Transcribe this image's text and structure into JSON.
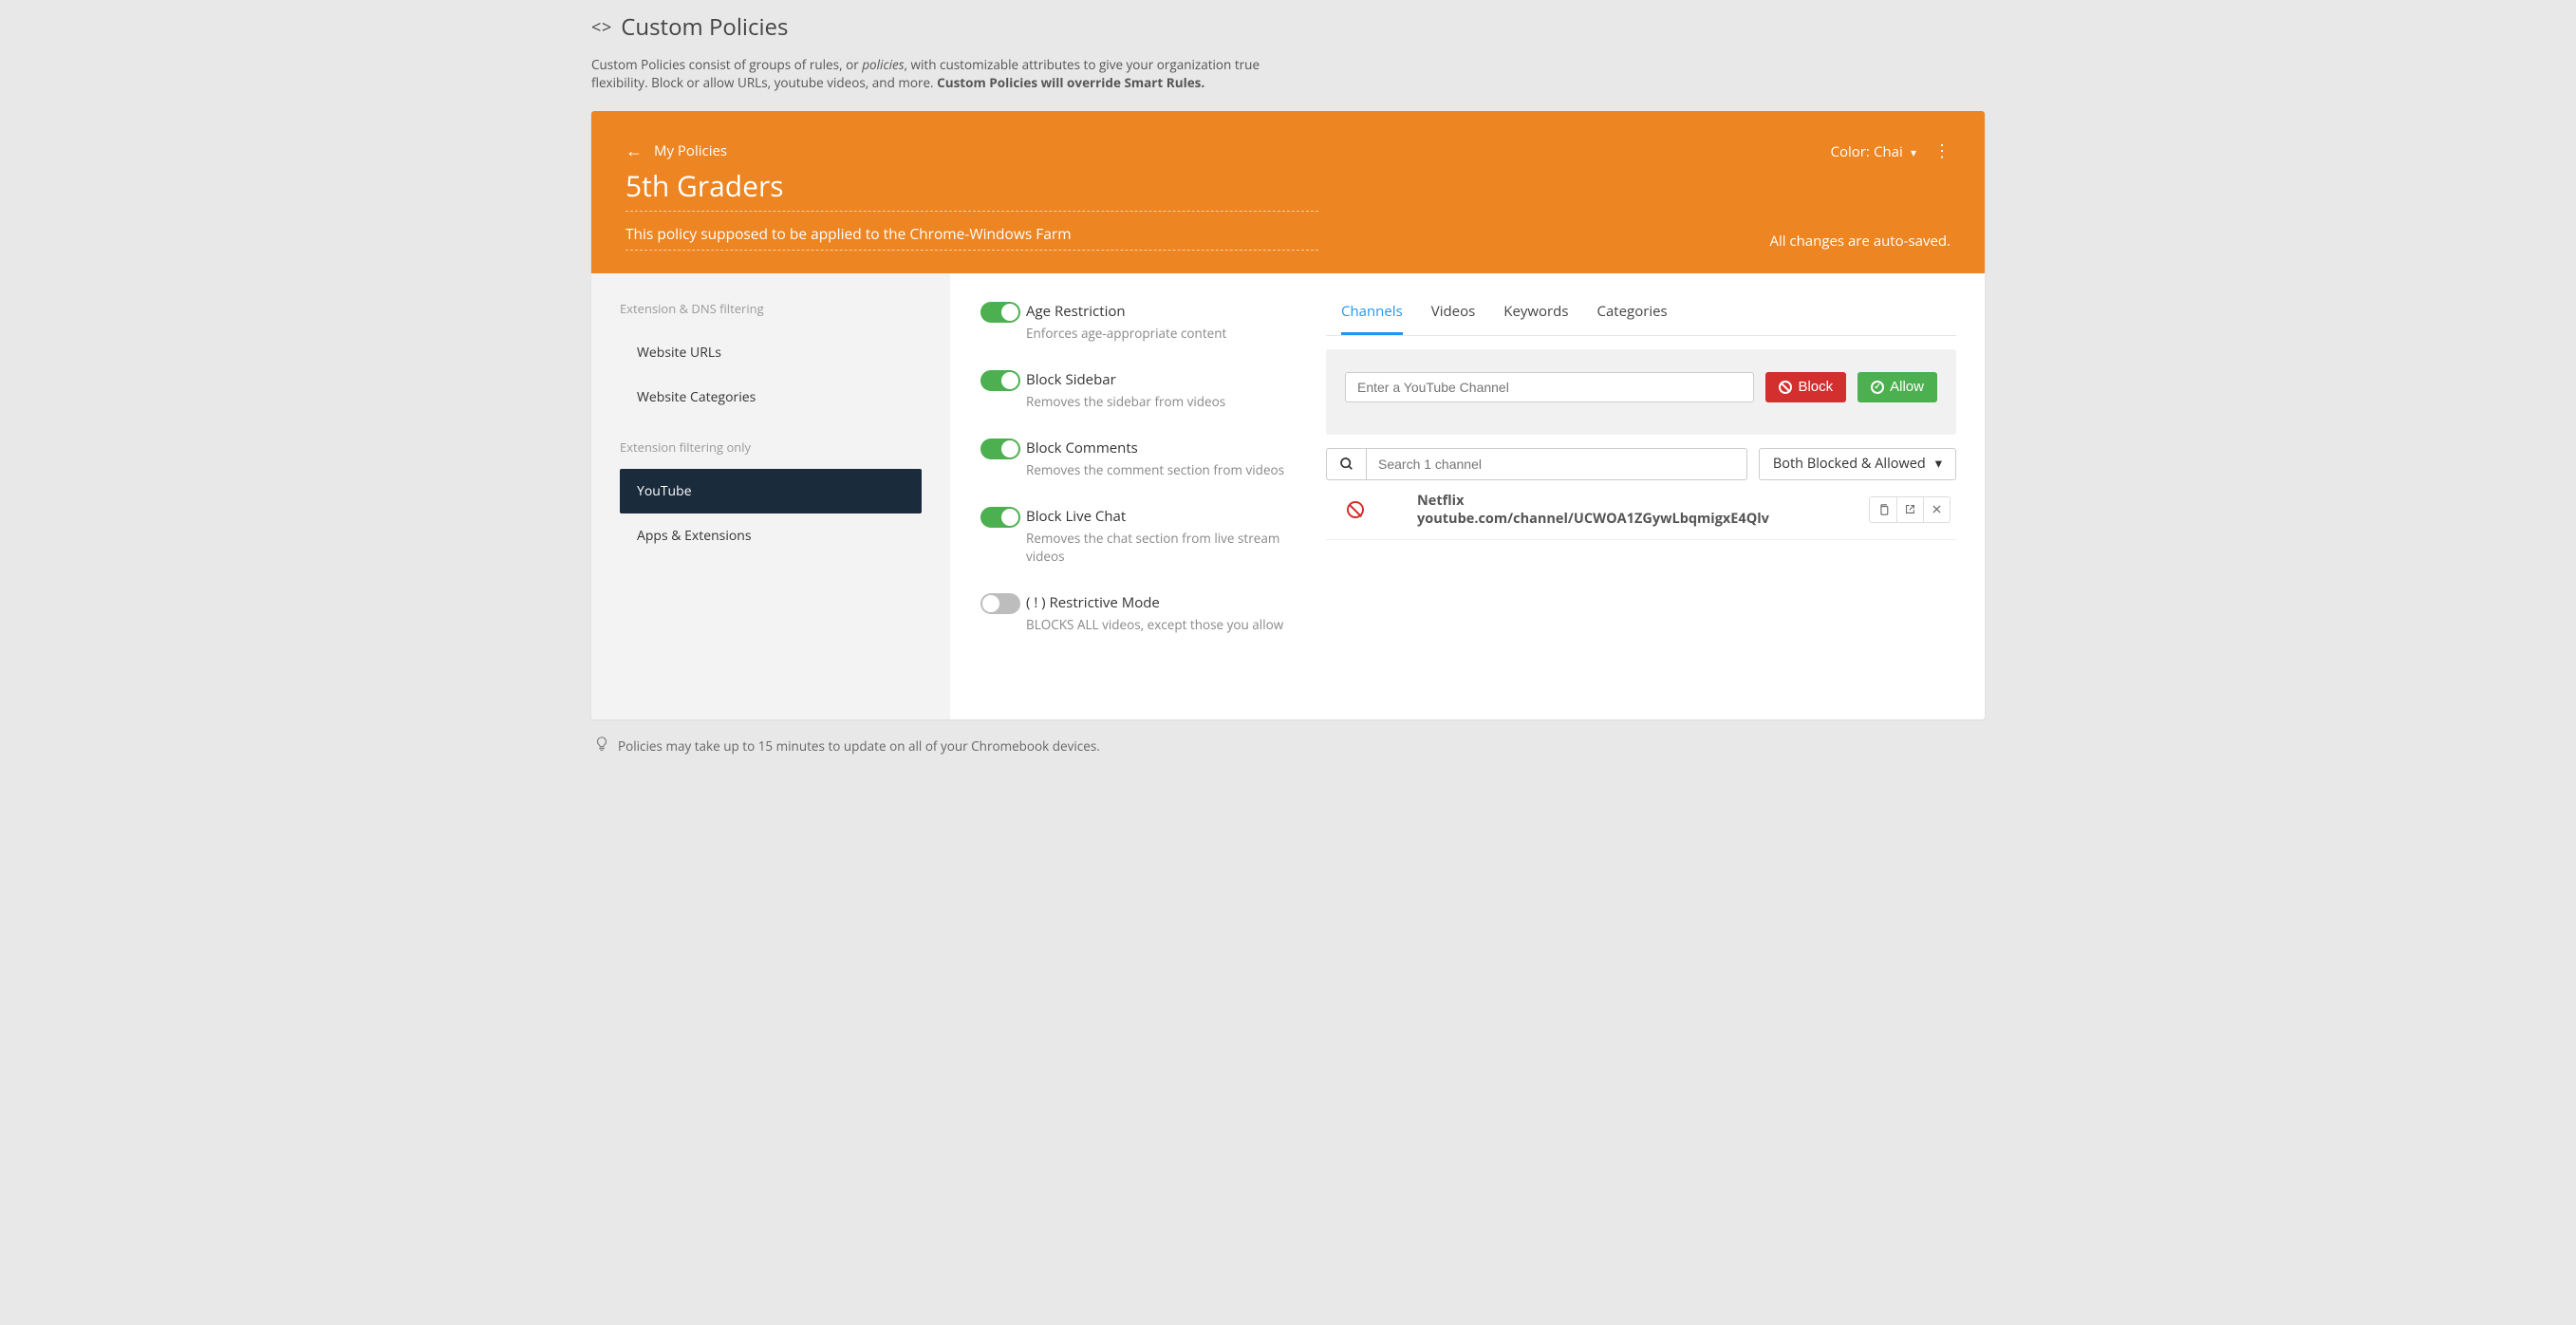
{
  "header": {
    "title": "Custom Policies",
    "desc_prefix": "Custom Policies consist of groups of rules, or ",
    "desc_em": "policies",
    "desc_mid": ", with customizable attributes to give your organization true flexibility. Block or allow URLs, youtube videos, and more. ",
    "desc_bold": "Custom Policies will override Smart Rules."
  },
  "policy_header": {
    "breadcrumb": "My Policies",
    "name": "5th Graders",
    "description": "This policy supposed to be applied to the Chrome-Windows Farm",
    "color_label": "Color:",
    "color_value": "Chai",
    "autosave": "All changes are auto-saved."
  },
  "sidebar": {
    "group1_label": "Extension & DNS filtering",
    "group2_label": "Extension filtering only",
    "items": {
      "website_urls": "Website URLs",
      "website_categories": "Website Categories",
      "youtube": "YouTube",
      "apps_extensions": "Apps & Extensions"
    }
  },
  "toggles": [
    {
      "title": "Age Restriction",
      "desc": "Enforces age-appropriate content",
      "on": true
    },
    {
      "title": "Block Sidebar",
      "desc": "Removes the sidebar from videos",
      "on": true
    },
    {
      "title": "Block Comments",
      "desc": "Removes the comment section from videos",
      "on": true
    },
    {
      "title": "Block Live Chat",
      "desc": "Removes the chat section from live stream videos",
      "on": true
    },
    {
      "title": "( ! ) Restrictive Mode",
      "desc": "BLOCKS ALL videos, except those you allow",
      "on": false
    }
  ],
  "tabs": [
    "Channels",
    "Videos",
    "Keywords",
    "Categories"
  ],
  "active_tab": 0,
  "channel_input_placeholder": "Enter a YouTube Channel",
  "block_label": "Block",
  "allow_label": "Allow",
  "search_placeholder": "Search 1 channel",
  "filter_label": "Both Blocked & Allowed",
  "channels": [
    {
      "name": "Netflix",
      "url": "youtube.com/channel/UCWOA1ZGywLbqmigxE4Qlv",
      "status": "blocked"
    }
  ],
  "footer_note": "Policies may take up to 15 minutes to update on all of your Chromebook devices."
}
